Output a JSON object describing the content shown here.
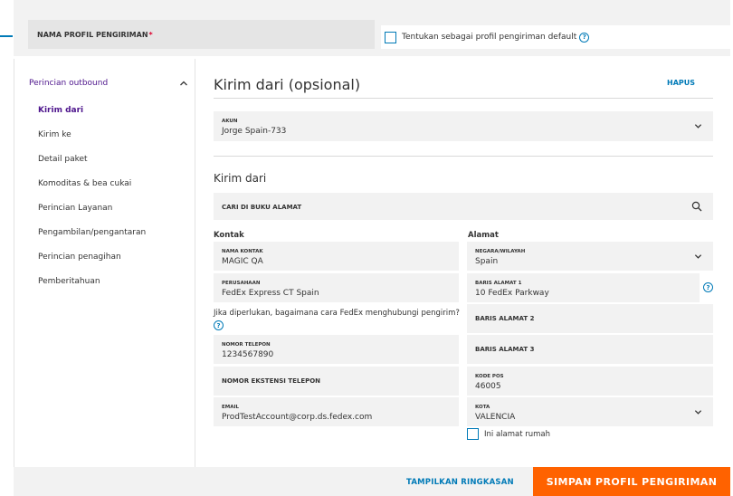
{
  "header": {
    "profile_name_label": "NAMA PROFIL PENGIRIMAN",
    "required_mark": "*",
    "default_checkbox_label": "Tentukan sebagai profil pengiriman default",
    "help_glyph": "?"
  },
  "sidebar": {
    "section_title": "Perincian outbound",
    "collapse_glyph": "^",
    "items": [
      {
        "label": "Kirim dari",
        "active": true
      },
      {
        "label": "Kirim ke",
        "active": false
      },
      {
        "label": "Detail paket",
        "active": false
      },
      {
        "label": "Komoditas & bea cukai",
        "active": false
      },
      {
        "label": "Perincian Layanan",
        "active": false
      },
      {
        "label": "Pengambilan/pengantaran",
        "active": false
      },
      {
        "label": "Perincian penagihan",
        "active": false
      },
      {
        "label": "Pemberitahuan",
        "active": false
      }
    ]
  },
  "main": {
    "title": "Kirim dari (opsional)",
    "delete_label": "HAPUS",
    "account": {
      "label": "AKUN",
      "value": "Jorge Spain-733"
    },
    "subtitle": "Kirim dari",
    "address_book_search": "CARI DI BUKU ALAMAT",
    "contact": {
      "heading": "Kontak",
      "name": {
        "label": "NAMA KONTAK",
        "value": "MAGIC QA"
      },
      "company": {
        "label": "PERUSAHAAN",
        "value": "FedEx Express CT Spain"
      },
      "question": "Jika diperlukan, bagaimana cara FedEx menghubungi pengirim?",
      "phone": {
        "label": "NOMOR TELEPON",
        "value": "1234567890"
      },
      "phone_ext": {
        "placeholder": "NOMOR EKSTENSI TELEPON"
      },
      "email": {
        "label": "EMAIL",
        "value": "ProdTestAccount@corp.ds.fedex.com"
      }
    },
    "address": {
      "heading": "Alamat",
      "country": {
        "label": "NEGARA/WILAYAH",
        "value": "Spain"
      },
      "line1": {
        "label": "BARIS ALAMAT 1",
        "value": "10 FedEx Parkway"
      },
      "line2": {
        "placeholder": "BARIS ALAMAT 2"
      },
      "line3": {
        "placeholder": "BARIS ALAMAT 3"
      },
      "postal": {
        "label": "KODE POS",
        "value": "46005"
      },
      "city": {
        "label": "KOTA",
        "value": "VALENCIA"
      },
      "residential_label": "Ini alamat rumah"
    }
  },
  "footer": {
    "summary_label": "TAMPILKAN RINGKASAN",
    "save_label": "SIMPAN PROFIL PENGIRIMAN"
  },
  "colors": {
    "primary_blue": "#007ab7",
    "fedex_purple": "#4d148c",
    "fedex_orange": "#ff6200",
    "field_gray": "#f2f2f2"
  }
}
